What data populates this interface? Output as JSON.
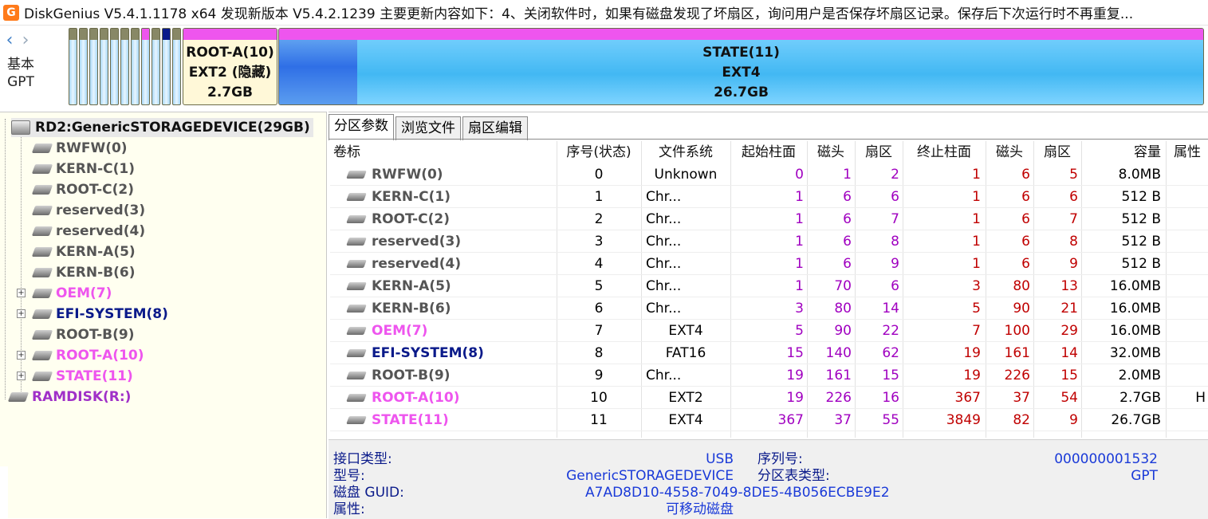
{
  "window": {
    "app_icon": "G",
    "title": "DiskGenius V5.4.1.1178 x64   发现新版本 V5.4.2.1239  主要更新内容如下：4、关闭软件时，如果有磁盘发现了坏扇区，询问用户是否保存坏扇区记录。保存后下次运行时不再重复..."
  },
  "diskmap": {
    "nav_prev": "‹",
    "nav_next": "›",
    "disk_kind_line1": "基本",
    "disk_kind_line2": "GPT",
    "root_a": {
      "name": "ROOT-A(10)",
      "fs": "EXT2 (隐藏)",
      "size": "2.7GB"
    },
    "state": {
      "name": "STATE(11)",
      "fs": "EXT4",
      "size": "26.7GB"
    }
  },
  "tree": {
    "disk": "RD2:GenericSTORAGEDEVICE(29GB)",
    "items": [
      {
        "label": "RWFW(0)"
      },
      {
        "label": "KERN-C(1)"
      },
      {
        "label": "ROOT-C(2)"
      },
      {
        "label": "reserved(3)"
      },
      {
        "label": "reserved(4)"
      },
      {
        "label": "KERN-A(5)"
      },
      {
        "label": "KERN-B(6)"
      },
      {
        "label": "OEM(7)"
      },
      {
        "label": "EFI-SYSTEM(8)"
      },
      {
        "label": "ROOT-B(9)"
      },
      {
        "label": "ROOT-A(10)"
      },
      {
        "label": "STATE(11)"
      }
    ],
    "ramdisk": "RAMDISK(R:)",
    "expander_symbol": "+"
  },
  "tabs": [
    "分区参数",
    "浏览文件",
    "扇区编辑"
  ],
  "table": {
    "headers": [
      "卷标",
      "序号(状态)",
      "文件系统",
      "起始柱面",
      "磁头",
      "扇区",
      "终止柱面",
      "磁头",
      "扇区",
      "容量",
      "属性"
    ],
    "rows": [
      {
        "name": "RWFW(0)",
        "idx": "0",
        "fs": "Unknown",
        "sc": "0",
        "sh": "1",
        "ss": "2",
        "ec": "1",
        "eh": "6",
        "es": "5",
        "size": "8.0MB",
        "attr": ""
      },
      {
        "name": "KERN-C(1)",
        "idx": "1",
        "fs": "Chr...",
        "sc": "1",
        "sh": "6",
        "ss": "6",
        "ec": "1",
        "eh": "6",
        "es": "6",
        "size": "512 B",
        "attr": ""
      },
      {
        "name": "ROOT-C(2)",
        "idx": "2",
        "fs": "Chr...",
        "sc": "1",
        "sh": "6",
        "ss": "7",
        "ec": "1",
        "eh": "6",
        "es": "7",
        "size": "512 B",
        "attr": ""
      },
      {
        "name": "reserved(3)",
        "idx": "3",
        "fs": "Chr...",
        "sc": "1",
        "sh": "6",
        "ss": "8",
        "ec": "1",
        "eh": "6",
        "es": "8",
        "size": "512 B",
        "attr": ""
      },
      {
        "name": "reserved(4)",
        "idx": "4",
        "fs": "Chr...",
        "sc": "1",
        "sh": "6",
        "ss": "9",
        "ec": "1",
        "eh": "6",
        "es": "9",
        "size": "512 B",
        "attr": ""
      },
      {
        "name": "KERN-A(5)",
        "idx": "5",
        "fs": "Chr...",
        "sc": "1",
        "sh": "70",
        "ss": "6",
        "ec": "3",
        "eh": "80",
        "es": "13",
        "size": "16.0MB",
        "attr": ""
      },
      {
        "name": "KERN-B(6)",
        "idx": "6",
        "fs": "Chr...",
        "sc": "3",
        "sh": "80",
        "ss": "14",
        "ec": "5",
        "eh": "90",
        "es": "21",
        "size": "16.0MB",
        "attr": ""
      },
      {
        "name": "OEM(7)",
        "idx": "7",
        "fs": "EXT4",
        "sc": "5",
        "sh": "90",
        "ss": "22",
        "ec": "7",
        "eh": "100",
        "es": "29",
        "size": "16.0MB",
        "attr": ""
      },
      {
        "name": "EFI-SYSTEM(8)",
        "idx": "8",
        "fs": "FAT16",
        "sc": "15",
        "sh": "140",
        "ss": "62",
        "ec": "19",
        "eh": "161",
        "es": "14",
        "size": "32.0MB",
        "attr": ""
      },
      {
        "name": "ROOT-B(9)",
        "idx": "9",
        "fs": "Chr...",
        "sc": "19",
        "sh": "161",
        "ss": "15",
        "ec": "19",
        "eh": "226",
        "es": "15",
        "size": "2.0MB",
        "attr": ""
      },
      {
        "name": "ROOT-A(10)",
        "idx": "10",
        "fs": "EXT2",
        "sc": "19",
        "sh": "226",
        "ss": "16",
        "ec": "367",
        "eh": "37",
        "es": "54",
        "size": "2.7GB",
        "attr": "H"
      },
      {
        "name": "STATE(11)",
        "idx": "11",
        "fs": "EXT4",
        "sc": "367",
        "sh": "37",
        "ss": "55",
        "ec": "3849",
        "eh": "82",
        "es": "9",
        "size": "26.7GB",
        "attr": ""
      }
    ]
  },
  "info": {
    "interface_label": "接口类型:",
    "interface_value": "USB",
    "serial_label": "序列号:",
    "serial_value": "000000001532",
    "model_label": "型号:",
    "model_value": "GenericSTORAGEDEVICE",
    "pt_label": "分区表类型:",
    "pt_value": "GPT",
    "guid_label": "磁盘 GUID:",
    "guid_value": "A7AD8D10-4558-7049-8DE5-4B056ECBE9E2",
    "attr_label": "属性:",
    "attr_value": "可移动磁盘"
  },
  "colors": {
    "pink": "#ee55ee",
    "navy": "#0a1a8a",
    "gray": "#555555",
    "purple": "#a030c8",
    "number": "#a000c0",
    "red": "#c00000"
  }
}
